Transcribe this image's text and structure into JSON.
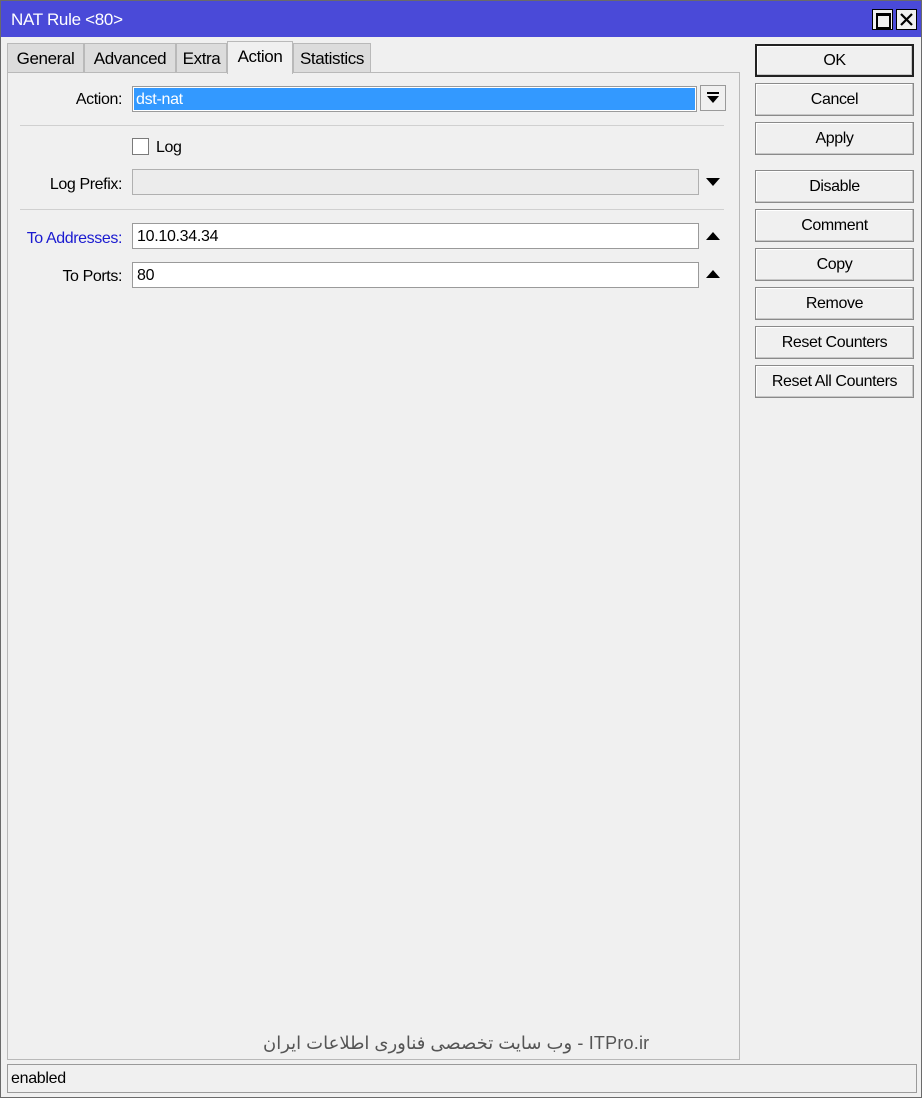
{
  "window": {
    "title": "NAT Rule <80>"
  },
  "tabs": [
    {
      "label": "General"
    },
    {
      "label": "Advanced"
    },
    {
      "label": "Extra"
    },
    {
      "label": "Action"
    },
    {
      "label": "Statistics"
    }
  ],
  "active_tab": "Action",
  "form": {
    "action": {
      "label": "Action:",
      "value": "dst-nat"
    },
    "log": {
      "label": "Log",
      "checked": false
    },
    "log_prefix": {
      "label": "Log Prefix:",
      "value": ""
    },
    "to_addresses": {
      "label": "To Addresses:",
      "value": "10.10.34.34"
    },
    "to_ports": {
      "label": "To Ports:",
      "value": "80"
    }
  },
  "buttons": {
    "ok": "OK",
    "cancel": "Cancel",
    "apply": "Apply",
    "disable": "Disable",
    "comment": "Comment",
    "copy": "Copy",
    "remove": "Remove",
    "reset_counters": "Reset Counters",
    "reset_all_counters": "Reset All Counters"
  },
  "watermark": "ITPro.ir - وب سایت تخصصی فناوری اطلاعات ایران",
  "status": "enabled",
  "colors": {
    "titlebar": "#4a4ad8",
    "selection": "#3399ff",
    "link_label": "#1a1ad0"
  }
}
